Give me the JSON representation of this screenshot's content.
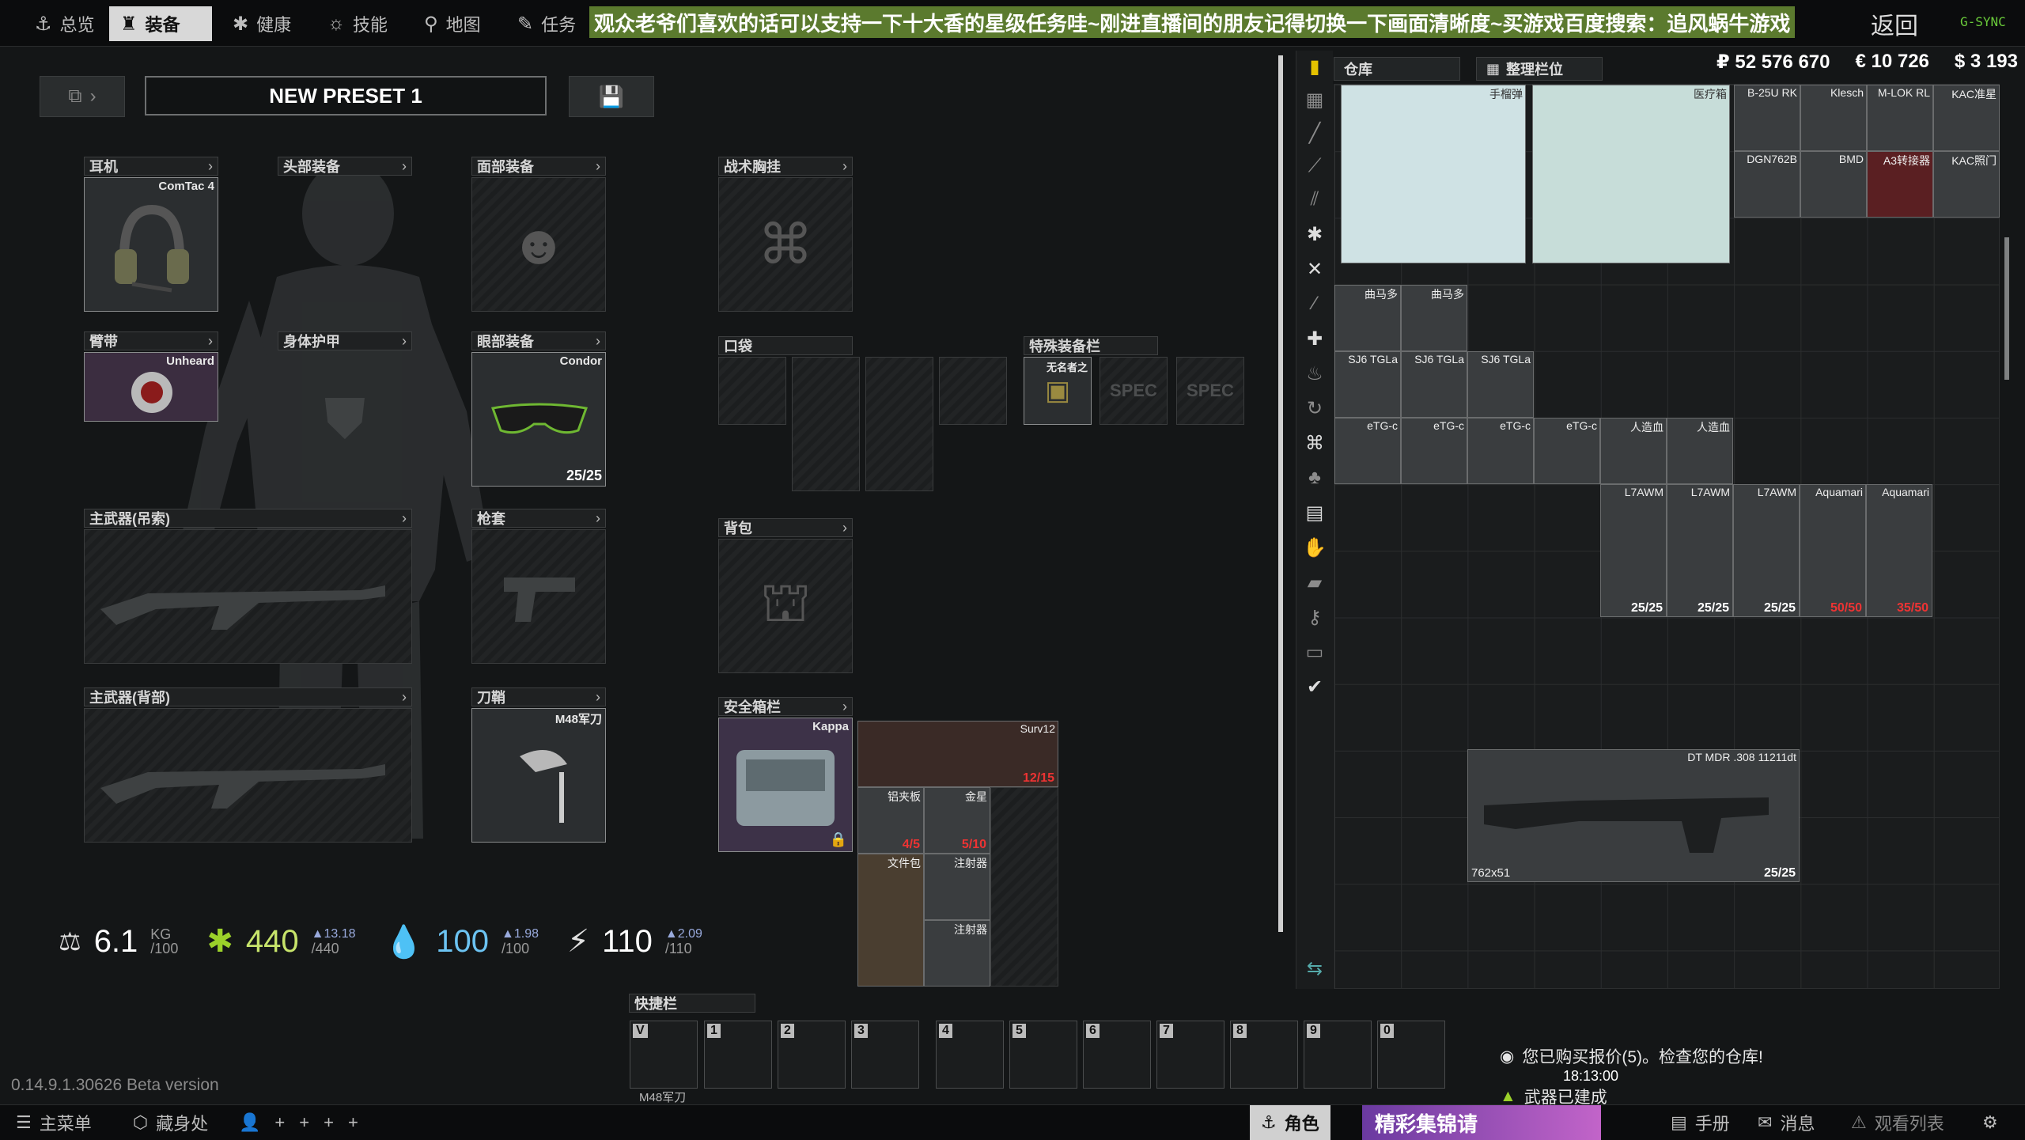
{
  "nav": {
    "tabs": [
      {
        "icon": "⚓",
        "label": "总览"
      },
      {
        "icon": "♜",
        "label": "装备"
      },
      {
        "icon": "✱",
        "label": "健康"
      },
      {
        "icon": "☼",
        "label": "技能"
      },
      {
        "icon": "⚲",
        "label": "地图"
      },
      {
        "icon": "✎",
        "label": "任务"
      }
    ],
    "banner": "观众老爷们喜欢的话可以支持一下十大香的星级任务哇~刚进直播间的朋友记得切换一下画面清晰度~买游戏百度搜索：追风蜗牛游戏",
    "back": "返回",
    "gsync": "G-SYNC"
  },
  "preset": {
    "name": "NEW PRESET 1"
  },
  "slots": {
    "earpiece": {
      "label": "耳机",
      "item": "ComTac 4"
    },
    "headwear": {
      "label": "头部装备"
    },
    "face": {
      "label": "面部装备"
    },
    "rig": {
      "label": "战术胸挂"
    },
    "armband": {
      "label": "臂带",
      "item": "Unheard"
    },
    "armor": {
      "label": "身体护甲"
    },
    "eyewear": {
      "label": "眼部装备",
      "item": "Condor",
      "count": "25/25"
    },
    "pockets": {
      "label": "口袋"
    },
    "special": {
      "label": "特殊装备栏",
      "item": "无名者之",
      "spec": "SPEC"
    },
    "primary_sling": {
      "label": "主武器(吊索)"
    },
    "holster": {
      "label": "枪套"
    },
    "backpack": {
      "label": "背包"
    },
    "primary_back": {
      "label": "主武器(背部)"
    },
    "scabbard": {
      "label": "刀鞘",
      "item": "M48军刀"
    },
    "secure": {
      "label": "安全箱栏",
      "item": "Kappa"
    }
  },
  "secure_contents": [
    {
      "name": "Surv12",
      "count": "12/15"
    },
    {
      "name": "铝夹板",
      "count": "4/5"
    },
    {
      "name": "金星",
      "count": "5/10"
    },
    {
      "name": "文件包",
      "count": ""
    },
    {
      "name": "注射器",
      "count": ""
    },
    {
      "name": "注射器",
      "count": ""
    }
  ],
  "stats": {
    "weight": {
      "value": "6.1",
      "unit": "KG",
      "max": "/100"
    },
    "health": {
      "value": "440",
      "max": "/440",
      "delta": "▲13.18"
    },
    "hydration": {
      "value": "100",
      "max": "/100",
      "delta": "▲1.98"
    },
    "energy": {
      "value": "110",
      "max": "/110",
      "delta": "▲2.09"
    }
  },
  "stash": {
    "tab_storage": "仓库",
    "tab_sort": "整理栏位",
    "currency": {
      "rub": "₽ 52 576 670",
      "eur": "€ 10 726",
      "usd": "$ 3 193"
    },
    "items": [
      {
        "name": "手榴弹",
        "count": ""
      },
      {
        "name": "医疗箱",
        "count": ""
      },
      {
        "name": "B-25U RK",
        "count": ""
      },
      {
        "name": "Klesch",
        "count": ""
      },
      {
        "name": "M-LOK RL",
        "count": ""
      },
      {
        "name": "KAC准星",
        "count": ""
      },
      {
        "name": "DGN762B",
        "count": ""
      },
      {
        "name": "BMD",
        "count": ""
      },
      {
        "name": "A3转接器",
        "count": ""
      },
      {
        "name": "KAC照门",
        "count": ""
      },
      {
        "name": "曲马多",
        "count": ""
      },
      {
        "name": "曲马多",
        "count": ""
      },
      {
        "name": "SJ6 TGLa",
        "count": ""
      },
      {
        "name": "SJ6 TGLa",
        "count": ""
      },
      {
        "name": "SJ6 TGLa",
        "count": ""
      },
      {
        "name": "eTG-c",
        "count": ""
      },
      {
        "name": "eTG-c",
        "count": ""
      },
      {
        "name": "eTG-c",
        "count": ""
      },
      {
        "name": "eTG-c",
        "count": ""
      },
      {
        "name": "人造血",
        "count": ""
      },
      {
        "name": "人造血",
        "count": ""
      },
      {
        "name": "L7AWM",
        "count": "25/25"
      },
      {
        "name": "L7AWM",
        "count": "25/25"
      },
      {
        "name": "L7AWM",
        "count": "25/25"
      },
      {
        "name": "Aquamari",
        "count": "50/50"
      },
      {
        "name": "Aquamari",
        "count": "35/50"
      },
      {
        "name": "DT MDR .308 11211dt",
        "count": "25/25",
        "caliber": "762x51"
      }
    ]
  },
  "quickbar": {
    "label": "快捷栏",
    "keys": [
      "V",
      "1",
      "2",
      "3",
      "4",
      "5",
      "6",
      "7",
      "8",
      "9",
      "0"
    ],
    "v_item": "M48军刀"
  },
  "version": "0.14.9.1.30626 Beta version",
  "notifications": [
    "您已购买报价(5)。检查您的仓库!",
    "武器已建成"
  ],
  "time": "18:13:00",
  "bottom": {
    "menu": "主菜单",
    "hideout": "藏身处",
    "character": "角色",
    "overlay": "精彩集锦请",
    "handbook": "手册",
    "messages": "消息",
    "watchlist": "观看列表"
  }
}
